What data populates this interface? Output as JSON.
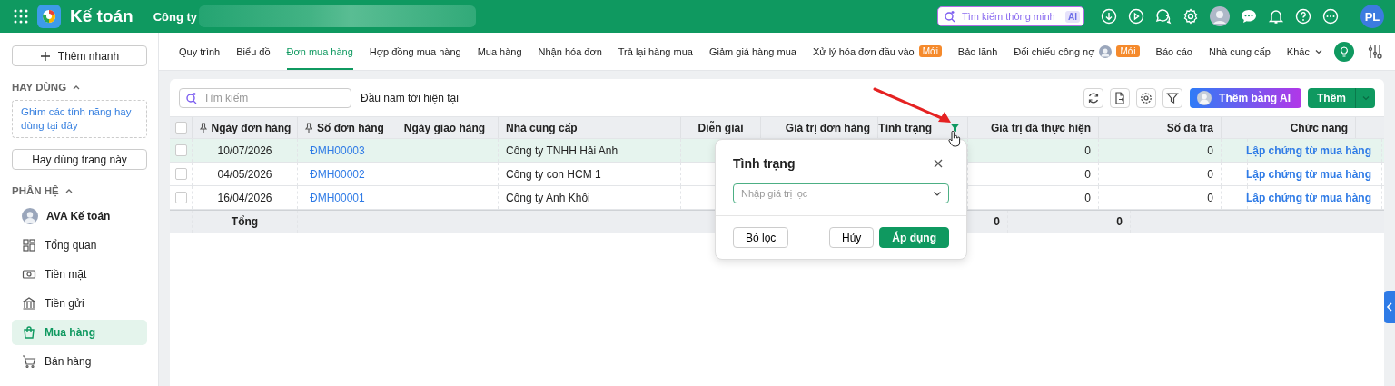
{
  "header": {
    "app_name": "Kế toán",
    "company": "Công ty",
    "search_placeholder": "Tìm kiếm thông minh",
    "ai_badge": "AI",
    "avatar_initials": "PL"
  },
  "sidebar": {
    "quick_add": "Thêm nhanh",
    "frequent": {
      "title": "HAY DÙNG",
      "expanded": true,
      "hint": "Ghim các tính năng hay dùng tại đây",
      "button": "Hay dùng trang này"
    },
    "modules": {
      "title": "PHÂN HỆ",
      "expanded": true,
      "items": [
        {
          "label": "AVA Kế toán",
          "kind": "assistant",
          "selected": false
        },
        {
          "label": "Tổng quan",
          "kind": "overview",
          "selected": false
        },
        {
          "label": "Tiền mặt",
          "kind": "cash",
          "selected": false
        },
        {
          "label": "Tiền gửi",
          "kind": "bank",
          "selected": false
        },
        {
          "label": "Mua hàng",
          "kind": "purchase",
          "selected": true
        },
        {
          "label": "Bán hàng",
          "kind": "sales",
          "selected": false
        }
      ]
    }
  },
  "tabs": [
    {
      "label": "Quy trình",
      "selected": false
    },
    {
      "label": "Biểu đồ",
      "selected": false
    },
    {
      "label": "Đơn mua hàng",
      "selected": true
    },
    {
      "label": "Hợp đồng mua hàng",
      "selected": false
    },
    {
      "label": "Mua hàng",
      "selected": false
    },
    {
      "label": "Nhận hóa đơn",
      "selected": false
    },
    {
      "label": "Trả lại hàng mua",
      "selected": false
    },
    {
      "label": "Giảm giá hàng mua",
      "selected": false
    },
    {
      "label": "Xử lý hóa đơn đầu vào",
      "selected": false,
      "badge": "Mới"
    },
    {
      "label": "Bảo lãnh",
      "selected": false
    },
    {
      "label": "Đối chiếu công nợ",
      "selected": false,
      "badge": "Mới",
      "avatar": true
    },
    {
      "label": "Báo cáo",
      "selected": false
    },
    {
      "label": "Nhà cung cấp",
      "selected": false
    },
    {
      "label": "Khác",
      "selected": false,
      "dropdown": true
    }
  ],
  "toolbar": {
    "search_placeholder": "Tìm kiếm",
    "period": "Đầu năm tới hiện tại",
    "ai_button": "Thêm bằng AI",
    "add_button": "Thêm"
  },
  "table": {
    "select_all_checked": false,
    "columns": [
      {
        "label": "Ngày đơn hàng",
        "pinned": true,
        "filtered": false
      },
      {
        "label": "Số đơn hàng",
        "pinned": true,
        "filtered": false
      },
      {
        "label": "Ngày giao hàng",
        "pinned": false,
        "filtered": false
      },
      {
        "label": "Nhà cung cấp",
        "pinned": false,
        "filtered": false
      },
      {
        "label": "Diễn giải",
        "pinned": false,
        "filtered": false
      },
      {
        "label": "Giá trị đơn hàng",
        "pinned": false,
        "filtered": false
      },
      {
        "label": "Tình trạng",
        "pinned": false,
        "filtered": true
      },
      {
        "label": "Giá trị đã thực hiện",
        "pinned": false,
        "filtered": false
      },
      {
        "label": "Số đã trả",
        "pinned": false,
        "filtered": false
      },
      {
        "label": "Chức năng",
        "pinned": false,
        "filtered": false
      }
    ],
    "rows": [
      {
        "date": "10/07/2026",
        "number": "ĐMH00003",
        "supplier": "Công ty TNHH Hải Anh",
        "executed": "0",
        "returned": "0",
        "action": "Lập chứng từ mua hàng",
        "selected": true,
        "checked": false
      },
      {
        "date": "04/05/2026",
        "number": "ĐMH00002",
        "supplier": "Công ty con HCM 1",
        "executed": "0",
        "returned": "0",
        "action": "Lập chứng từ mua hàng",
        "selected": false,
        "checked": false
      },
      {
        "date": "16/04/2026",
        "number": "ĐMH00001",
        "supplier": "Công ty Anh Khôi",
        "executed": "0",
        "returned": "0",
        "action": "Lập chứng từ mua hàng",
        "selected": false,
        "checked": false
      }
    ],
    "totals": {
      "label": "Tổng",
      "executed": "0",
      "returned": "0"
    }
  },
  "filter_popup": {
    "title": "Tình trạng",
    "placeholder": "Nhập giá trị lọc",
    "clear": "Bỏ lọc",
    "cancel": "Hủy",
    "apply": "Áp dụng"
  }
}
